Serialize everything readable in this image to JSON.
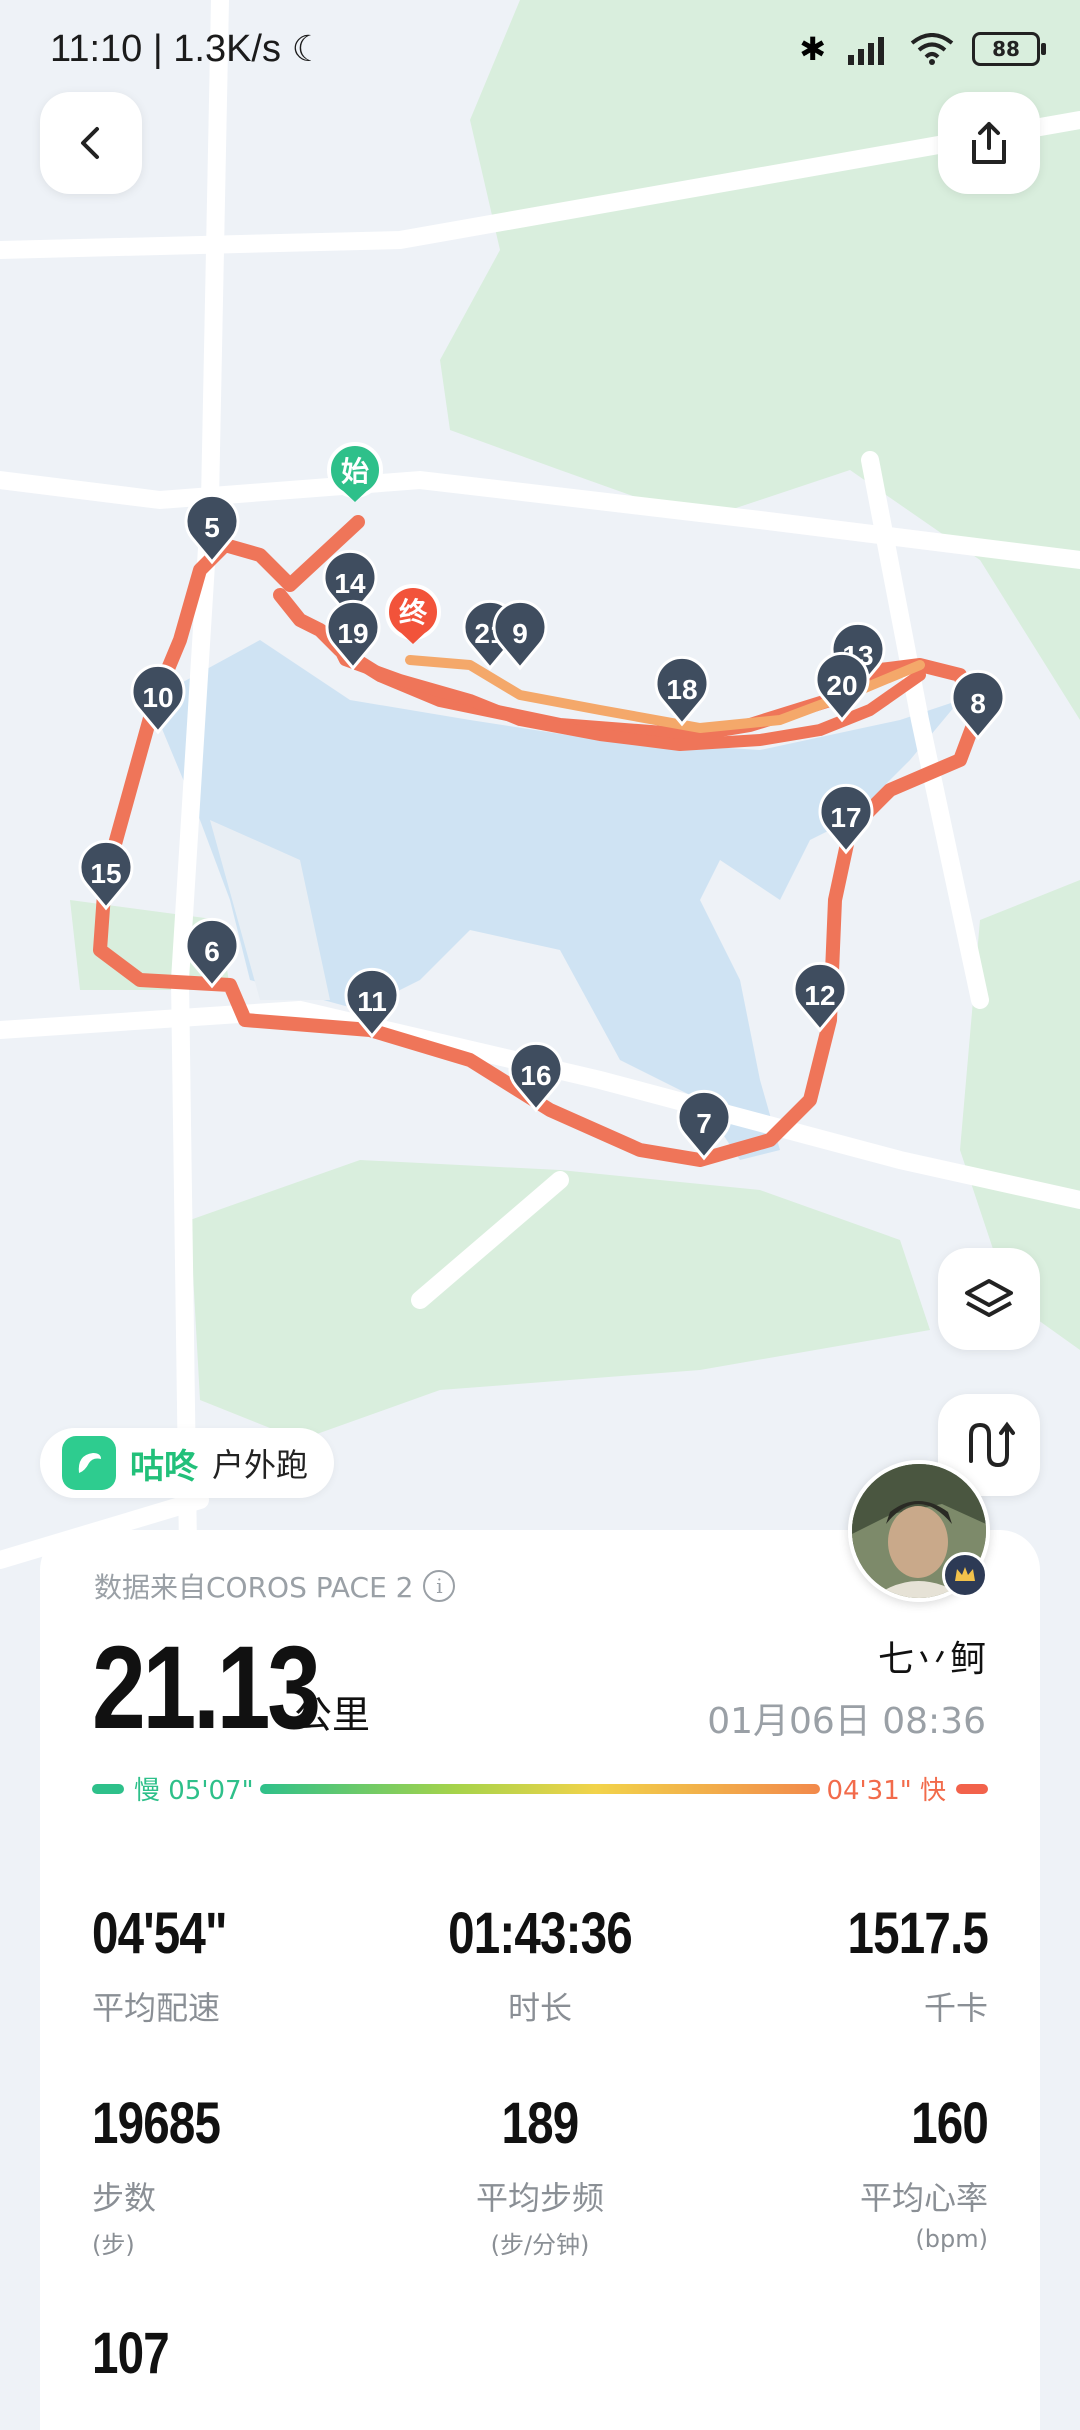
{
  "status_bar": {
    "time": "11:10 | 1.3K/s",
    "battery": "88"
  },
  "colors": {
    "route": "#ef7559",
    "route_dark": "#e0603f",
    "water": "#cfe3f3",
    "park": "#d9eedd",
    "marker": "#3f4d5f",
    "start": "#2ec08a",
    "end": "#f2533a"
  },
  "map": {
    "start_label": "始",
    "end_label": "终",
    "km_markers": [
      "5",
      "14",
      "19",
      "21",
      "9",
      "18",
      "13",
      "20",
      "8",
      "10",
      "15",
      "17",
      "6",
      "11",
      "12",
      "16",
      "7"
    ]
  },
  "app": {
    "name": "咕咚",
    "type": "户外跑"
  },
  "summary": {
    "source": "数据来自COROS PACE 2",
    "distance": "21.13",
    "distance_unit": "公里",
    "username": "七丷鲄",
    "datetime": "01月06日 08:36",
    "pace_slow_label": "慢 05'07\"",
    "pace_fast_label": "04'31\" 快"
  },
  "stats": [
    {
      "value": "04'54\"",
      "label": "平均配速",
      "unit": ""
    },
    {
      "value": "01:43:36",
      "label": "时长",
      "unit": ""
    },
    {
      "value": "1517.5",
      "label": "千卡",
      "unit": ""
    },
    {
      "value": "19685",
      "label": "步数",
      "unit": "(步)"
    },
    {
      "value": "189",
      "label": "平均步频",
      "unit": "(步/分钟)"
    },
    {
      "value": "160",
      "label": "平均心率",
      "unit": "(bpm)"
    },
    {
      "value": "107",
      "label": "",
      "unit": ""
    }
  ]
}
